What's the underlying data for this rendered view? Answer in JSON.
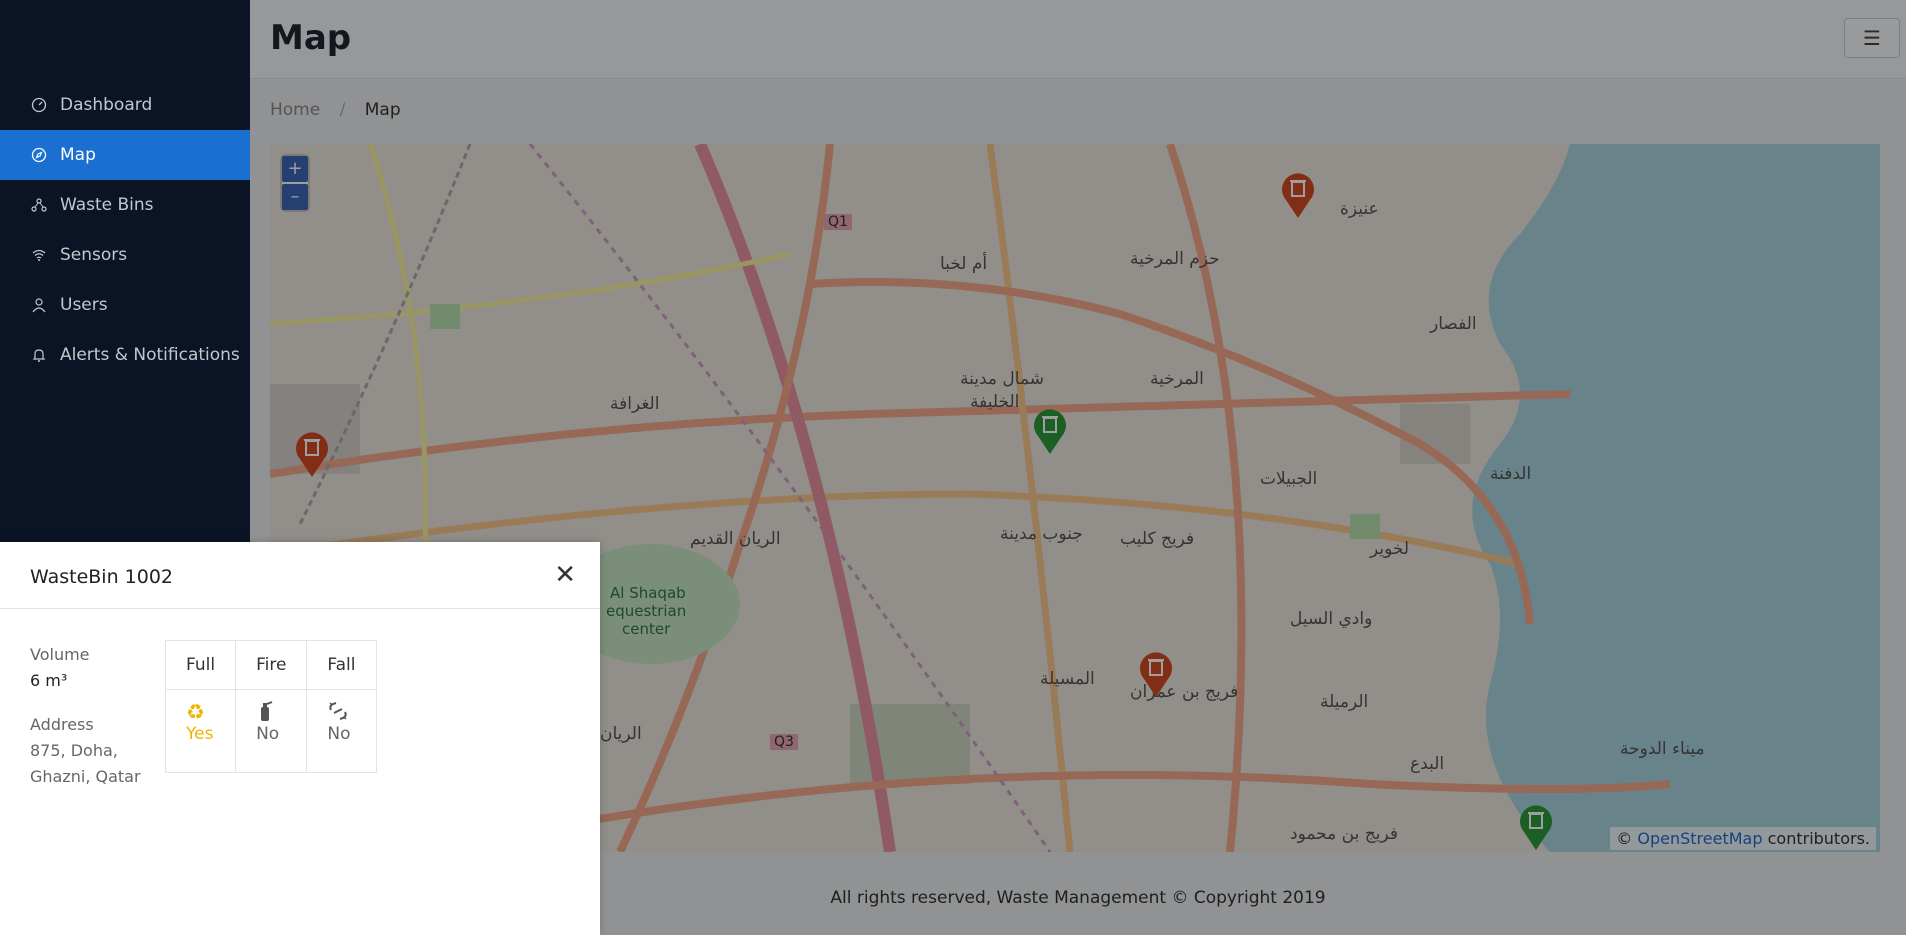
{
  "sidebar": {
    "items": [
      {
        "label": "Dashboard",
        "icon": "gauge-icon",
        "active": false
      },
      {
        "label": "Map",
        "icon": "compass-icon",
        "active": true
      },
      {
        "label": "Waste Bins",
        "icon": "nodes-icon",
        "active": false
      },
      {
        "label": "Sensors",
        "icon": "wifi-icon",
        "active": false
      },
      {
        "label": "Users",
        "icon": "user-icon",
        "active": false
      },
      {
        "label": "Alerts & Notifications",
        "icon": "bell-icon",
        "active": false
      }
    ]
  },
  "header": {
    "title": "Map",
    "menu_icon": "☰"
  },
  "breadcrumb": {
    "home": "Home",
    "separator": "/",
    "current": "Map"
  },
  "map": {
    "zoom_in": "+",
    "zoom_out": "–",
    "attribution_prefix": "©",
    "attribution_link": "OpenStreetMap",
    "attribution_suffix": "contributors.",
    "labels": {
      "l1": "أم لخبا",
      "l2": "حزم المرخية",
      "l3": "عنيزة",
      "l4": "شمال مدينة",
      "l5": "الخليفة",
      "l6": "المرخية",
      "l7": "الغرافة",
      "l8": "الجبيلات",
      "l9": "الدفنة",
      "l10": "الريان القديم",
      "l11": "جنوب مدينة",
      "l12": "فريج كليب",
      "l13": "Al Shaqab",
      "l14": "equestrian",
      "l15": "center",
      "l16": "وادي السيل",
      "l17": "المسيلة",
      "l18": "فريج بن عمران",
      "l19": "الرميلة",
      "l20": "ميناء الدوحة",
      "l21": "فريج بن محمود",
      "l22": "Q1",
      "l23": "Q3",
      "l24": "الريان",
      "l25": "لخوير",
      "l26": "البدع",
      "l27": "الفصار"
    }
  },
  "footer": {
    "text": "All rights reserved, Waste Management © Copyright 2019"
  },
  "popup": {
    "title": "WasteBin 1002",
    "close": "✕",
    "volume_label": "Volume",
    "volume_value": "6 m³",
    "address_label": "Address",
    "address_value": "875, Doha, Ghazni, Qatar",
    "columns": [
      "Full",
      "Fire",
      "Fall"
    ],
    "values": [
      "Yes",
      "No",
      "No"
    ],
    "status_icons": [
      "recycle-icon",
      "fire-extinguisher-icon",
      "broken-link-icon"
    ]
  },
  "colors": {
    "accent": "#1a6fd0",
    "sidebar_bg": "#0a1424",
    "pin_red": "#d24a23",
    "pin_green": "#2e9a3a",
    "yes": "#f0b400"
  }
}
